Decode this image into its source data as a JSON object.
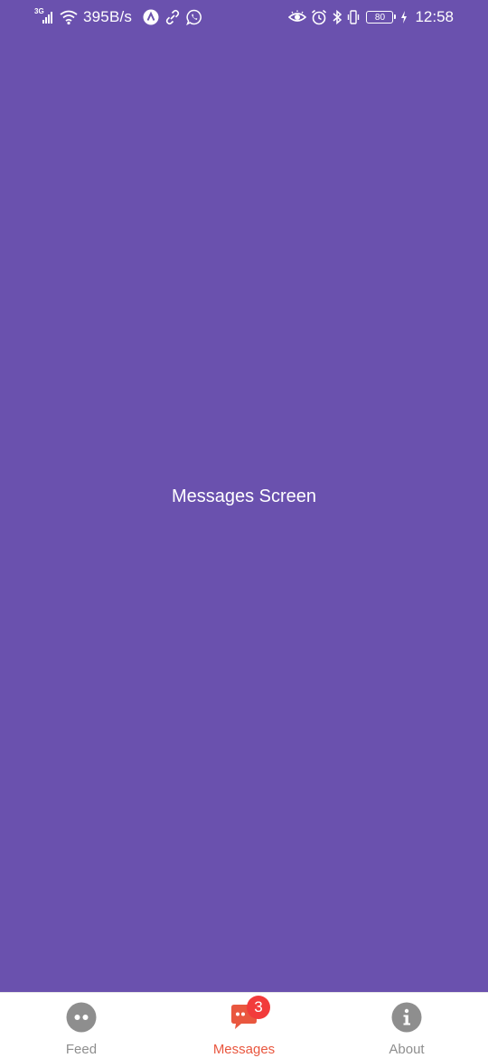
{
  "status_bar": {
    "network_type": "3G",
    "data_speed": "395B/s",
    "battery_level": "80",
    "time": "12:58"
  },
  "main": {
    "title": "Messages Screen",
    "background_color": "#6a51ae"
  },
  "tab_bar": {
    "tabs": [
      {
        "label": "Feed",
        "icon": "feed-icon",
        "active": false
      },
      {
        "label": "Messages",
        "icon": "chat-icon",
        "active": true,
        "badge": "3"
      },
      {
        "label": "About",
        "icon": "info-icon",
        "active": false
      }
    ],
    "active_color": "#e9573f",
    "inactive_color": "#8e8e8e",
    "badge_color": "#f23b3b"
  }
}
